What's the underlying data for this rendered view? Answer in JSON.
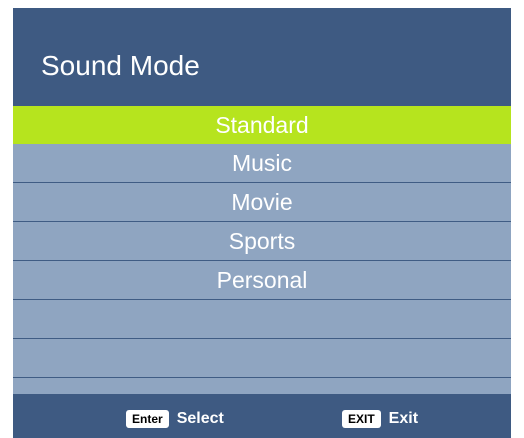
{
  "menu": {
    "title": "Sound Mode",
    "items": [
      {
        "label": "Standard"
      },
      {
        "label": "Music"
      },
      {
        "label": "Movie"
      },
      {
        "label": "Sports"
      },
      {
        "label": "Personal"
      }
    ],
    "selected_index": 0
  },
  "footer": {
    "enter_key": "Enter",
    "enter_label": "Select",
    "exit_key": "EXIT",
    "exit_label": "Exit"
  },
  "colors": {
    "header_bg": "#3e5a82",
    "row_bg": "#8fa5c1",
    "selected_bg": "#b6e41e"
  }
}
